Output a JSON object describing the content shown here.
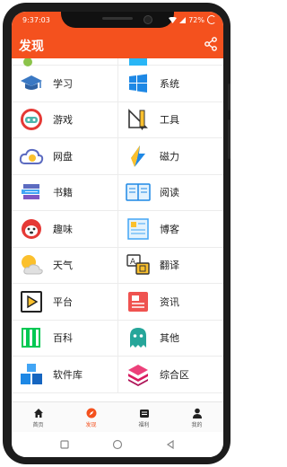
{
  "status": {
    "time": "9:37:03",
    "battery": "72%"
  },
  "appbar": {
    "title": "发现",
    "share_icon": "share-icon"
  },
  "grid": {
    "rows": [
      {
        "left": {
          "label": "学习",
          "icon": "graduation-cap-icon"
        },
        "right": {
          "label": "系统",
          "icon": "windows-icon"
        }
      },
      {
        "left": {
          "label": "游戏",
          "icon": "game-robot-icon"
        },
        "right": {
          "label": "工具",
          "icon": "ruler-tools-icon"
        }
      },
      {
        "left": {
          "label": "网盘",
          "icon": "cloud-drive-icon"
        },
        "right": {
          "label": "磁力",
          "icon": "magnet-bolt-icon"
        }
      },
      {
        "left": {
          "label": "书籍",
          "icon": "books-icon"
        },
        "right": {
          "label": "阅读",
          "icon": "open-book-icon"
        }
      },
      {
        "left": {
          "label": "趣味",
          "icon": "funny-dog-icon"
        },
        "right": {
          "label": "博客",
          "icon": "blog-icon"
        }
      },
      {
        "left": {
          "label": "天气",
          "icon": "weather-sun-cloud-icon"
        },
        "right": {
          "label": "翻译",
          "icon": "translate-icon"
        }
      },
      {
        "left": {
          "label": "平台",
          "icon": "platform-play-icon"
        },
        "right": {
          "label": "资讯",
          "icon": "news-icon"
        }
      },
      {
        "left": {
          "label": "百科",
          "icon": "encyclopedia-icon"
        },
        "right": {
          "label": "其他",
          "icon": "ghost-icon"
        }
      },
      {
        "left": {
          "label": "软件库",
          "icon": "software-boxes-icon"
        },
        "right": {
          "label": "综合区",
          "icon": "layers-icon"
        }
      }
    ]
  },
  "bottom_nav": [
    {
      "label": "首页",
      "icon": "home-icon",
      "active": false
    },
    {
      "label": "发现",
      "icon": "discover-icon",
      "active": true
    },
    {
      "label": "福利",
      "icon": "gift-icon",
      "active": false
    },
    {
      "label": "我的",
      "icon": "user-icon",
      "active": false
    }
  ],
  "colors": {
    "accent": "#f4511e"
  }
}
